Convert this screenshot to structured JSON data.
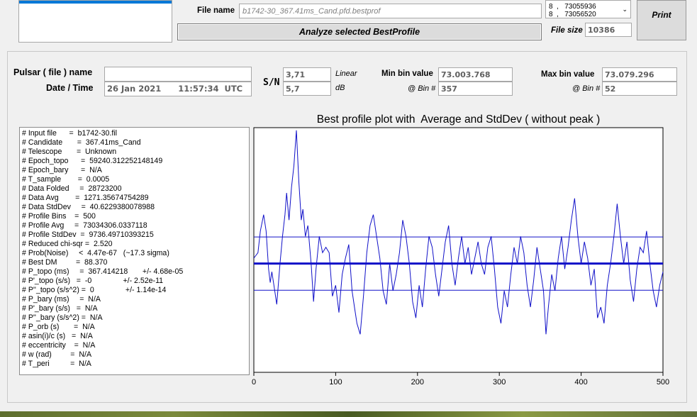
{
  "top": {
    "filename_label": "File name",
    "filename_value": "b1742-30_367.41ms_Cand.pfd.bestprof",
    "analyze_label": "Analyze selected BestProfile",
    "filesize_label": "File size",
    "filesize_value": "10386",
    "print_label": "Print",
    "dropdown_lines": [
      "8  ,   73055936",
      "8  ,   73056520"
    ]
  },
  "info": {
    "pulsar_label": "Pulsar ( file ) name",
    "pulsar_value": "",
    "date_label": "Date / Time",
    "date_value": "26 Jan 2021      11:57:34  UTC",
    "sn_label": "S/N",
    "sn_linear": "3,71",
    "sn_linear_unit": "Linear",
    "sn_db": "5,7",
    "sn_db_unit": "dB",
    "min_label": "Min bin value",
    "min_value": "73.003.768",
    "min_bin_label": "@ Bin #",
    "min_bin": "357",
    "max_label": "Max bin value",
    "max_value": "73.079.296",
    "max_bin_label": "@ Bin #",
    "max_bin": "52"
  },
  "params": [
    "# Input file      =  b1742-30.fil",
    "# Candidate       =  367.41ms_Cand",
    "# Telescope       =  Unknown",
    "# Epoch_topo      =  59240.312252148149",
    "# Epoch_bary      =  N/A",
    "# T_sample        =  0.0005",
    "# Data Folded     =  28723200",
    "# Data Avg        =  1271.35674754289",
    "# Data StdDev     =  40.6229380078988",
    "# Profile Bins    =  500",
    "# Profile Avg     =  73034306.0337118",
    "# Profile StdDev  =  9736.49710393215",
    "# Reduced chi-sqr =  2.520",
    "# Prob(Noise)     <  4.47e-67   (~17.3 sigma)",
    "# Best DM         =  88.370",
    "# P_topo (ms)     =  367.414218       +/- 4.68e-05",
    "# P'_topo (s/s)   =  -0               +/- 2.52e-11",
    "# P''_topo (s/s^2) =  0               +/- 1.14e-14",
    "# P_bary (ms)     =  N/A",
    "# P'_bary (s/s)   =  N/A",
    "# P''_bary (s/s^2) =  N/A",
    "# P_orb (s)       =  N/A",
    "# asin(i)/c (s)   =  N/A",
    "# eccentricity    =  N/A",
    "# w (rad)         =  N/A",
    "# T_peri          =  N/A"
  ],
  "chart_data": {
    "type": "line",
    "title": "Best profile plot with  Average and StdDev ( without peak )",
    "xlim": [
      0,
      500
    ],
    "ylim": [
      72990000,
      73080000
    ],
    "xticks": [
      0,
      100,
      200,
      300,
      400,
      500
    ],
    "average": 73030000,
    "average_plus_std": 73039800,
    "average_minus_std": 73020200,
    "grid": false,
    "series": [
      {
        "values_at_x": [
          [
            0,
            73032000
          ],
          [
            5,
            73034000
          ],
          [
            8,
            73042000
          ],
          [
            12,
            73048000
          ],
          [
            15,
            73042000
          ],
          [
            18,
            73028000
          ],
          [
            20,
            73023000
          ],
          [
            22,
            73027000
          ],
          [
            25,
            73021000
          ],
          [
            28,
            73015000
          ],
          [
            32,
            73030000
          ],
          [
            35,
            73040000
          ],
          [
            38,
            73048000
          ],
          [
            40,
            73056000
          ],
          [
            43,
            73046000
          ],
          [
            46,
            73058000
          ],
          [
            49,
            73066000
          ],
          [
            52,
            73079000
          ],
          [
            55,
            73060000
          ],
          [
            58,
            73046000
          ],
          [
            60,
            73050000
          ],
          [
            63,
            73040000
          ],
          [
            66,
            73044000
          ],
          [
            70,
            73030000
          ],
          [
            73,
            73016000
          ],
          [
            76,
            73028000
          ],
          [
            80,
            73040000
          ],
          [
            84,
            73034000
          ],
          [
            88,
            73036000
          ],
          [
            92,
            73034000
          ],
          [
            96,
            73018000
          ],
          [
            100,
            73022000
          ],
          [
            104,
            73012000
          ],
          [
            108,
            73026000
          ],
          [
            112,
            73032000
          ],
          [
            116,
            73037000
          ],
          [
            120,
            73020000
          ],
          [
            123,
            73014000
          ],
          [
            126,
            73008000
          ],
          [
            130,
            73004000
          ],
          [
            134,
            73018000
          ],
          [
            138,
            73034000
          ],
          [
            142,
            73044000
          ],
          [
            146,
            73048000
          ],
          [
            150,
            73040000
          ],
          [
            154,
            73032000
          ],
          [
            158,
            73020000
          ],
          [
            162,
            73015000
          ],
          [
            166,
            73030000
          ],
          [
            170,
            73020000
          ],
          [
            174,
            73026000
          ],
          [
            178,
            73034000
          ],
          [
            182,
            73046000
          ],
          [
            186,
            73040000
          ],
          [
            190,
            73030000
          ],
          [
            194,
            73016000
          ],
          [
            198,
            73010000
          ],
          [
            202,
            73022000
          ],
          [
            206,
            73014000
          ],
          [
            210,
            73028000
          ],
          [
            214,
            73040000
          ],
          [
            218,
            73036000
          ],
          [
            222,
            73026000
          ],
          [
            226,
            73018000
          ],
          [
            230,
            73028000
          ],
          [
            234,
            73038000
          ],
          [
            238,
            73044000
          ],
          [
            242,
            73030000
          ],
          [
            246,
            73022000
          ],
          [
            250,
            73032000
          ],
          [
            254,
            73040000
          ],
          [
            258,
            73030000
          ],
          [
            262,
            73036000
          ],
          [
            266,
            73026000
          ],
          [
            270,
            73032000
          ],
          [
            274,
            73038000
          ],
          [
            278,
            73030000
          ],
          [
            282,
            73026000
          ],
          [
            286,
            73036000
          ],
          [
            290,
            73040000
          ],
          [
            294,
            73028000
          ],
          [
            298,
            73014000
          ],
          [
            302,
            73008000
          ],
          [
            306,
            73020000
          ],
          [
            310,
            73014000
          ],
          [
            314,
            73026000
          ],
          [
            318,
            73036000
          ],
          [
            322,
            73030000
          ],
          [
            326,
            73040000
          ],
          [
            330,
            73034000
          ],
          [
            334,
            73022000
          ],
          [
            338,
            73014000
          ],
          [
            342,
            73024000
          ],
          [
            346,
            73036000
          ],
          [
            350,
            73028000
          ],
          [
            354,
            73020000
          ],
          [
            357,
            73004000
          ],
          [
            360,
            73014000
          ],
          [
            364,
            73026000
          ],
          [
            368,
            73020000
          ],
          [
            372,
            73032000
          ],
          [
            376,
            73040000
          ],
          [
            380,
            73028000
          ],
          [
            384,
            73036000
          ],
          [
            388,
            73046000
          ],
          [
            392,
            73054000
          ],
          [
            396,
            73040000
          ],
          [
            400,
            73030000
          ],
          [
            404,
            73038000
          ],
          [
            408,
            73032000
          ],
          [
            412,
            73022000
          ],
          [
            416,
            73028000
          ],
          [
            420,
            73010000
          ],
          [
            424,
            73014000
          ],
          [
            428,
            73008000
          ],
          [
            432,
            73022000
          ],
          [
            436,
            73030000
          ],
          [
            440,
            73040000
          ],
          [
            444,
            73052000
          ],
          [
            448,
            73040000
          ],
          [
            452,
            73030000
          ],
          [
            456,
            73038000
          ],
          [
            460,
            73024000
          ],
          [
            464,
            73016000
          ],
          [
            468,
            73028000
          ],
          [
            472,
            73036000
          ],
          [
            476,
            73034000
          ],
          [
            480,
            73042000
          ],
          [
            484,
            73030000
          ],
          [
            488,
            73020000
          ],
          [
            492,
            73014000
          ],
          [
            496,
            73022000
          ],
          [
            500,
            73027000
          ]
        ]
      }
    ]
  }
}
